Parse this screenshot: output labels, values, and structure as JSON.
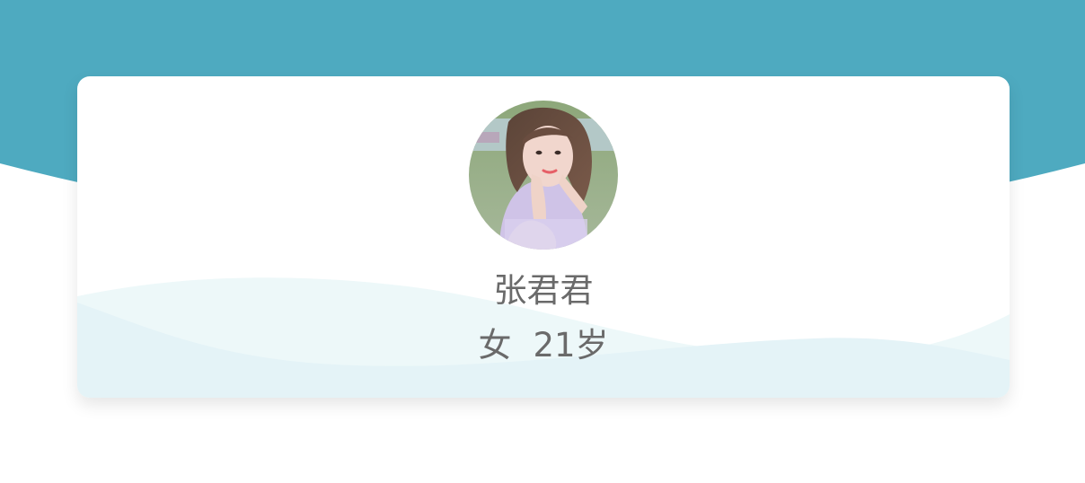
{
  "profile": {
    "name": "张君君",
    "gender": "女",
    "age": "21岁"
  },
  "colors": {
    "header": "#4eaac0",
    "card_background": "#ffffff",
    "text": "#6a6a6a",
    "wave_light": "#edf8f9",
    "wave_mid": "#e4f3f7"
  }
}
